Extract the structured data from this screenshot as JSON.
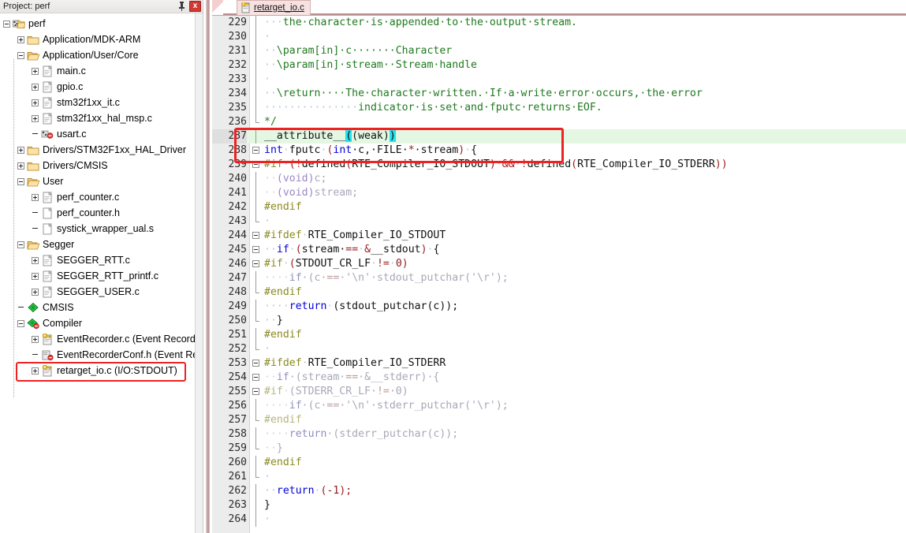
{
  "project_pane": {
    "title": "Project: perf",
    "pin_icon": "pin-icon",
    "close_label": "x",
    "tree": [
      {
        "depth": 0,
        "label": "perf",
        "icon": "project-icon",
        "expander": "minus"
      },
      {
        "depth": 1,
        "label": "Application/MDK-ARM",
        "icon": "folder-closed-icon",
        "expander": "plus"
      },
      {
        "depth": 1,
        "label": "Application/User/Core",
        "icon": "folder-open-icon",
        "expander": "minus"
      },
      {
        "depth": 2,
        "label": "main.c",
        "icon": "c-file-icon",
        "expander": "plus"
      },
      {
        "depth": 2,
        "label": "gpio.c",
        "icon": "c-file-icon",
        "expander": "plus"
      },
      {
        "depth": 2,
        "label": "stm32f1xx_it.c",
        "icon": "c-file-icon",
        "expander": "plus"
      },
      {
        "depth": 2,
        "label": "stm32f1xx_hal_msp.c",
        "icon": "c-file-icon",
        "expander": "plus"
      },
      {
        "depth": 2,
        "label": "usart.c",
        "icon": "c-file-modified-icon",
        "expander": "none"
      },
      {
        "depth": 1,
        "label": "Drivers/STM32F1xx_HAL_Driver",
        "icon": "folder-closed-icon",
        "expander": "plus"
      },
      {
        "depth": 1,
        "label": "Drivers/CMSIS",
        "icon": "folder-closed-icon",
        "expander": "plus"
      },
      {
        "depth": 1,
        "label": "User",
        "icon": "folder-open-icon",
        "expander": "minus"
      },
      {
        "depth": 2,
        "label": "perf_counter.c",
        "icon": "c-file-icon",
        "expander": "plus"
      },
      {
        "depth": 2,
        "label": "perf_counter.h",
        "icon": "h-file-icon",
        "expander": "none"
      },
      {
        "depth": 2,
        "label": "systick_wrapper_ual.s",
        "icon": "asm-file-icon",
        "expander": "none"
      },
      {
        "depth": 1,
        "label": "Segger",
        "icon": "folder-open-icon",
        "expander": "minus"
      },
      {
        "depth": 2,
        "label": "SEGGER_RTT.c",
        "icon": "c-file-icon",
        "expander": "plus"
      },
      {
        "depth": 2,
        "label": "SEGGER_RTT_printf.c",
        "icon": "c-file-icon",
        "expander": "plus"
      },
      {
        "depth": 2,
        "label": "SEGGER_USER.c",
        "icon": "c-file-icon",
        "expander": "plus"
      },
      {
        "depth": 1,
        "label": "CMSIS",
        "icon": "green-diamond-icon",
        "expander": "none"
      },
      {
        "depth": 1,
        "label": "Compiler",
        "icon": "green-diamond-modified-icon",
        "expander": "minus"
      },
      {
        "depth": 2,
        "label": "EventRecorder.c (Event Recorder)",
        "icon": "rte-key-file-icon",
        "expander": "plus"
      },
      {
        "depth": 2,
        "label": "EventRecorderConf.h (Event Recorde",
        "icon": "rte-config-file-icon",
        "expander": "none"
      },
      {
        "depth": 2,
        "label": "retarget_io.c (I/O:STDOUT)",
        "icon": "rte-key-file-icon",
        "expander": "plus"
      }
    ],
    "highlight_row_label": "retarget_io.c (I/O:STDOUT)"
  },
  "editor": {
    "tabs": [
      {
        "label": "retarget_io.c",
        "icon": "rte-key-file-icon",
        "active": true
      }
    ],
    "highlight_lines": [
      237,
      238
    ],
    "current_line": 237,
    "first_line": 229,
    "last_line": 264,
    "lines": [
      {
        "n": 229,
        "fold": "line",
        "gray": false,
        "tokens": [
          {
            "t": "···",
            "c": "c-ws"
          },
          {
            "t": "the·character·is·appended·to·the·output·stream.",
            "c": "c-com"
          }
        ]
      },
      {
        "n": 230,
        "fold": "line",
        "gray": false,
        "tokens": [
          {
            "t": "·",
            "c": "c-ws"
          }
        ]
      },
      {
        "n": 231,
        "fold": "line",
        "gray": false,
        "tokens": [
          {
            "t": "··",
            "c": "c-ws"
          },
          {
            "t": "\\param[in]·c·······Character",
            "c": "c-com"
          }
        ]
      },
      {
        "n": 232,
        "fold": "line",
        "gray": false,
        "tokens": [
          {
            "t": "··",
            "c": "c-ws"
          },
          {
            "t": "\\param[in]·stream··Stream·handle",
            "c": "c-com"
          }
        ]
      },
      {
        "n": 233,
        "fold": "line",
        "gray": false,
        "tokens": [
          {
            "t": "·",
            "c": "c-ws"
          }
        ]
      },
      {
        "n": 234,
        "fold": "line",
        "gray": false,
        "tokens": [
          {
            "t": "··",
            "c": "c-ws"
          },
          {
            "t": "\\return····The·character·written.·If·a·write·error·occurs,·the·error",
            "c": "c-com"
          }
        ]
      },
      {
        "n": 235,
        "fold": "line",
        "gray": false,
        "tokens": [
          {
            "t": "···············",
            "c": "c-ws"
          },
          {
            "t": "indicator·is·set·and·fputc·returns·EOF.",
            "c": "c-com"
          }
        ]
      },
      {
        "n": 236,
        "fold": "end",
        "gray": false,
        "tokens": [
          {
            "t": "*/",
            "c": "c-com"
          }
        ]
      },
      {
        "n": 237,
        "fold": "line",
        "gray": false,
        "tokens": [
          {
            "t": "__attribute__",
            "c": "c-plain"
          },
          {
            "t": "(",
            "c": "c-match"
          },
          {
            "t": "(weak)",
            "c": "c-plain"
          },
          {
            "t": ")",
            "c": "c-match"
          }
        ]
      },
      {
        "n": 238,
        "fold": "box",
        "gray": false,
        "tokens": [
          {
            "t": "int",
            "c": "c-kw"
          },
          {
            "t": "·",
            "c": "c-ws"
          },
          {
            "t": "fputc",
            "c": "c-plain"
          },
          {
            "t": "·",
            "c": "c-ws"
          },
          {
            "t": "(",
            "c": "c-pun"
          },
          {
            "t": "int",
            "c": "c-kw"
          },
          {
            "t": "·c,·FILE·",
            "c": "c-plain"
          },
          {
            "t": "*",
            "c": "c-pun"
          },
          {
            "t": "·stream",
            "c": "c-plain"
          },
          {
            "t": ")",
            "c": "c-pun"
          },
          {
            "t": "·",
            "c": "c-ws"
          },
          {
            "t": "{",
            "c": "c-plain"
          }
        ]
      },
      {
        "n": 239,
        "fold": "box",
        "gray": false,
        "tokens": [
          {
            "t": "#if",
            "c": "c-pp"
          },
          {
            "t": "·",
            "c": "c-ws"
          },
          {
            "t": "(",
            "c": "c-pun"
          },
          {
            "t": "!",
            "c": "c-pun"
          },
          {
            "t": "defined",
            "c": "c-plain"
          },
          {
            "t": "(",
            "c": "c-pun"
          },
          {
            "t": "RTE_Compiler_IO_STDOUT",
            "c": "c-plain"
          },
          {
            "t": ")",
            "c": "c-pun"
          },
          {
            "t": "·",
            "c": "c-ws"
          },
          {
            "t": "&&",
            "c": "c-pun"
          },
          {
            "t": "·",
            "c": "c-ws"
          },
          {
            "t": "!",
            "c": "c-pun"
          },
          {
            "t": "defined",
            "c": "c-plain"
          },
          {
            "t": "(",
            "c": "c-pun"
          },
          {
            "t": "RTE_Compiler_IO_STDERR",
            "c": "c-plain"
          },
          {
            "t": "))",
            "c": "c-pun"
          }
        ]
      },
      {
        "n": 240,
        "fold": "line",
        "gray": true,
        "tokens": [
          {
            "t": "··",
            "c": "c-wsg"
          },
          {
            "t": "(void)",
            "c": "c-void"
          },
          {
            "t": "c;",
            "c": "c-gray"
          }
        ]
      },
      {
        "n": 241,
        "fold": "line",
        "gray": true,
        "tokens": [
          {
            "t": "··",
            "c": "c-wsg"
          },
          {
            "t": "(void)",
            "c": "c-void"
          },
          {
            "t": "stream;",
            "c": "c-gray"
          }
        ]
      },
      {
        "n": 242,
        "fold": "line",
        "gray": false,
        "tokens": [
          {
            "t": "#endif",
            "c": "c-pp"
          }
        ]
      },
      {
        "n": 243,
        "fold": "end",
        "gray": false,
        "tokens": [
          {
            "t": "·",
            "c": "c-ws"
          }
        ]
      },
      {
        "n": 244,
        "fold": "box",
        "gray": false,
        "tokens": [
          {
            "t": "#ifdef",
            "c": "c-pp"
          },
          {
            "t": "·",
            "c": "c-ws"
          },
          {
            "t": "RTE_Compiler_IO_STDOUT",
            "c": "c-plain"
          }
        ]
      },
      {
        "n": 245,
        "fold": "box",
        "gray": false,
        "tokens": [
          {
            "t": "··",
            "c": "c-ws"
          },
          {
            "t": "if",
            "c": "c-kw"
          },
          {
            "t": "·",
            "c": "c-ws"
          },
          {
            "t": "(",
            "c": "c-pun"
          },
          {
            "t": "stream·",
            "c": "c-plain"
          },
          {
            "t": "==",
            "c": "c-pun"
          },
          {
            "t": "·",
            "c": "c-ws"
          },
          {
            "t": "&",
            "c": "c-pun"
          },
          {
            "t": "__stdout",
            "c": "c-plain"
          },
          {
            "t": ")",
            "c": "c-pun"
          },
          {
            "t": "·",
            "c": "c-ws"
          },
          {
            "t": "{",
            "c": "c-plain"
          }
        ]
      },
      {
        "n": 246,
        "fold": "box",
        "gray": false,
        "tokens": [
          {
            "t": "#if",
            "c": "c-pp"
          },
          {
            "t": "·",
            "c": "c-ws"
          },
          {
            "t": "(",
            "c": "c-pun"
          },
          {
            "t": "STDOUT_CR_LF",
            "c": "c-plain"
          },
          {
            "t": "·",
            "c": "c-ws"
          },
          {
            "t": "!=",
            "c": "c-pun"
          },
          {
            "t": "·",
            "c": "c-ws"
          },
          {
            "t": "0",
            "c": "c-num"
          },
          {
            "t": ")",
            "c": "c-pun"
          }
        ]
      },
      {
        "n": 247,
        "fold": "line",
        "gray": true,
        "tokens": [
          {
            "t": "····",
            "c": "c-wsg"
          },
          {
            "t": "if",
            "c": "c-graykw"
          },
          {
            "t": "·(c·",
            "c": "c-gray"
          },
          {
            "t": "==",
            "c": "c-graypun"
          },
          {
            "t": "·",
            "c": "c-gray"
          },
          {
            "t": "'\\n'",
            "c": "c-gray"
          },
          {
            "t": "·stdout_putchar(",
            "c": "c-gray"
          },
          {
            "t": "'\\r'",
            "c": "c-gray"
          },
          {
            "t": ");",
            "c": "c-gray"
          }
        ]
      },
      {
        "n": 248,
        "fold": "end",
        "gray": false,
        "tokens": [
          {
            "t": "#endif",
            "c": "c-pp"
          }
        ]
      },
      {
        "n": 249,
        "fold": "line",
        "gray": false,
        "tokens": [
          {
            "t": "····",
            "c": "c-ws"
          },
          {
            "t": "return",
            "c": "c-kw"
          },
          {
            "t": "·",
            "c": "c-ws"
          },
          {
            "t": "(stdout_putchar(c));",
            "c": "c-plain"
          }
        ]
      },
      {
        "n": 250,
        "fold": "end",
        "gray": false,
        "tokens": [
          {
            "t": "··",
            "c": "c-ws"
          },
          {
            "t": "}",
            "c": "c-plain"
          }
        ]
      },
      {
        "n": 251,
        "fold": "line",
        "gray": false,
        "tokens": [
          {
            "t": "#endif",
            "c": "c-pp"
          }
        ]
      },
      {
        "n": 252,
        "fold": "end",
        "gray": false,
        "tokens": [
          {
            "t": "·",
            "c": "c-ws"
          }
        ]
      },
      {
        "n": 253,
        "fold": "box",
        "gray": false,
        "tokens": [
          {
            "t": "#ifdef",
            "c": "c-pp"
          },
          {
            "t": "·",
            "c": "c-ws"
          },
          {
            "t": "RTE_Compiler_IO_STDERR",
            "c": "c-plain"
          }
        ]
      },
      {
        "n": 254,
        "fold": "box",
        "gray": true,
        "tokens": [
          {
            "t": "··",
            "c": "c-wsg"
          },
          {
            "t": "if",
            "c": "c-graykw"
          },
          {
            "t": "·",
            "c": "c-gray"
          },
          {
            "t": "(stream·",
            "c": "c-gray"
          },
          {
            "t": "==",
            "c": "c-graypun"
          },
          {
            "t": "·&__stderr)·{",
            "c": "c-gray"
          }
        ]
      },
      {
        "n": 255,
        "fold": "box",
        "gray": true,
        "tokens": [
          {
            "t": "#if",
            "c": "c-graypp"
          },
          {
            "t": "·",
            "c": "c-wsg"
          },
          {
            "t": "(STDERR_CR_LF·",
            "c": "c-gray"
          },
          {
            "t": "!=",
            "c": "c-graypun"
          },
          {
            "t": "·",
            "c": "c-gray"
          },
          {
            "t": "0",
            "c": "c-gray"
          },
          {
            "t": ")",
            "c": "c-gray"
          }
        ]
      },
      {
        "n": 256,
        "fold": "line",
        "gray": true,
        "tokens": [
          {
            "t": "····",
            "c": "c-wsg"
          },
          {
            "t": "if",
            "c": "c-graykw"
          },
          {
            "t": "·(c·",
            "c": "c-gray"
          },
          {
            "t": "==",
            "c": "c-graypun"
          },
          {
            "t": "·",
            "c": "c-gray"
          },
          {
            "t": "'\\n'",
            "c": "c-gray"
          },
          {
            "t": "·stderr_putchar(",
            "c": "c-gray"
          },
          {
            "t": "'\\r'",
            "c": "c-gray"
          },
          {
            "t": ");",
            "c": "c-gray"
          }
        ]
      },
      {
        "n": 257,
        "fold": "end",
        "gray": true,
        "tokens": [
          {
            "t": "#endif",
            "c": "c-graypp"
          }
        ]
      },
      {
        "n": 258,
        "fold": "line",
        "gray": true,
        "tokens": [
          {
            "t": "····",
            "c": "c-wsg"
          },
          {
            "t": "return",
            "c": "c-graykw"
          },
          {
            "t": "·",
            "c": "c-gray"
          },
          {
            "t": "(stderr_putchar(c));",
            "c": "c-gray"
          }
        ]
      },
      {
        "n": 259,
        "fold": "end",
        "gray": true,
        "tokens": [
          {
            "t": "··",
            "c": "c-wsg"
          },
          {
            "t": "}",
            "c": "c-gray"
          }
        ]
      },
      {
        "n": 260,
        "fold": "line",
        "gray": false,
        "tokens": [
          {
            "t": "#endif",
            "c": "c-pp"
          }
        ]
      },
      {
        "n": 261,
        "fold": "end",
        "gray": false,
        "tokens": [
          {
            "t": "·",
            "c": "c-ws"
          }
        ]
      },
      {
        "n": 262,
        "fold": "line",
        "gray": false,
        "tokens": [
          {
            "t": "··",
            "c": "c-ws"
          },
          {
            "t": "return",
            "c": "c-kw"
          },
          {
            "t": "·",
            "c": "c-ws"
          },
          {
            "t": "(",
            "c": "c-pun"
          },
          {
            "t": "-1",
            "c": "c-num"
          },
          {
            "t": ");",
            "c": "c-pun"
          }
        ]
      },
      {
        "n": 263,
        "fold": "line",
        "gray": false,
        "tokens": [
          {
            "t": "}",
            "c": "c-plain"
          }
        ]
      },
      {
        "n": 264,
        "fold": "line",
        "gray": false,
        "tokens": [
          {
            "t": "·",
            "c": "c-ws"
          }
        ]
      }
    ]
  },
  "colors": {
    "highlight_red": "#ee2222",
    "current_line_bg": "#e3f7e3",
    "comment_green": "#1f7a1f",
    "keyword_blue": "#0000dd",
    "preproc_olive": "#8a8a22",
    "punct_red": "#9b1b1b",
    "match_cyan": "#25e0ec",
    "inactive_gray": "#a8a8b8"
  }
}
